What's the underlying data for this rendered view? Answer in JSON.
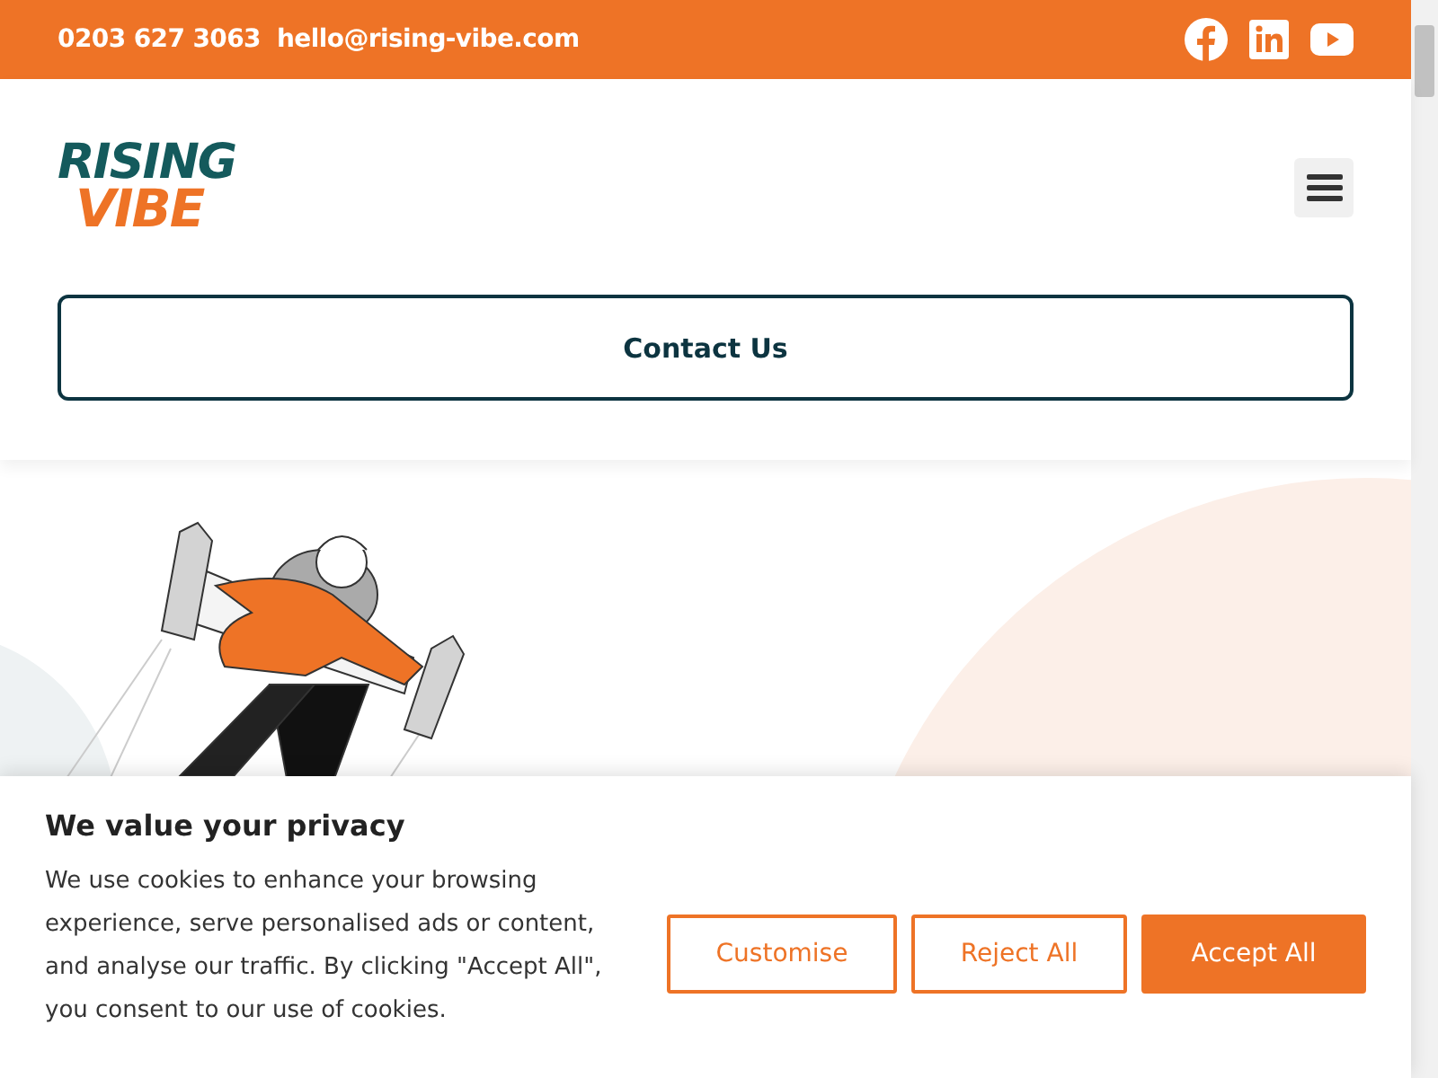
{
  "top_bar": {
    "phone": "0203 627 3063",
    "email": "hello@rising-vibe.com",
    "social": [
      {
        "kind": "facebook"
      },
      {
        "kind": "linkedin"
      },
      {
        "kind": "youtube"
      }
    ]
  },
  "header": {
    "logo": {
      "line_1": "RISING",
      "line_2": "VIBE"
    },
    "contact_button": "Contact Us"
  },
  "cookie_banner": {
    "title": "We value your privacy",
    "text": "We use cookies to enhance your browsing experience, serve personalised ads or content, and analyse our traffic. By clicking \"Accept All\", you consent to our use of cookies.",
    "buttons": [
      {
        "label": "Customise",
        "kind": "outline"
      },
      {
        "label": "Reject All",
        "kind": "outline"
      },
      {
        "label": "Accept All",
        "kind": "filled"
      }
    ]
  }
}
